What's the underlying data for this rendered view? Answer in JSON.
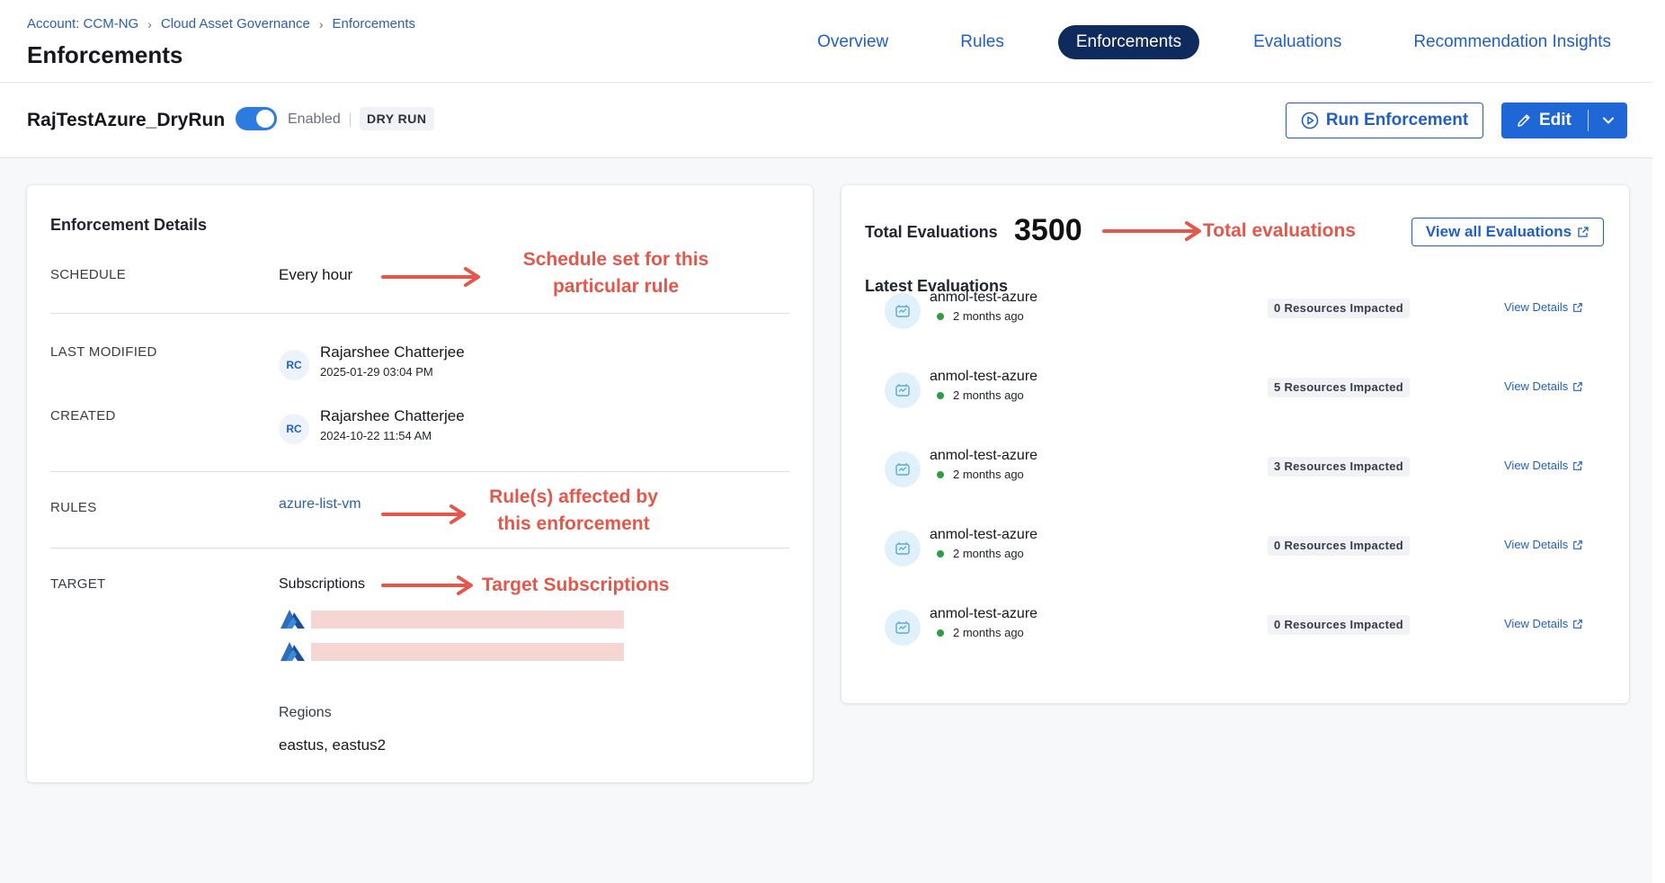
{
  "breadcrumb": {
    "account": "Account: CCM-NG",
    "section": "Cloud Asset Governance",
    "current": "Enforcements"
  },
  "header": {
    "title": "Enforcements"
  },
  "tabs": [
    "Overview",
    "Rules",
    "Enforcements",
    "Evaluations",
    "Recommendation Insights"
  ],
  "active_tab": "Enforcements",
  "enforcement": {
    "name": "RajTestAzure_DryRun",
    "enabled": true,
    "enabled_label": "Enabled",
    "mode_badge": "DRY RUN",
    "run_button": "Run Enforcement",
    "edit_button": "Edit"
  },
  "details": {
    "title": "Enforcement Details",
    "schedule_label": "SCHEDULE",
    "schedule_value": "Every hour",
    "last_modified_label": "LAST MODIFIED",
    "last_modified": {
      "initials": "RC",
      "name": "Rajarshee Chatterjee",
      "date": "2025-01-29 03:04 PM"
    },
    "created_label": "CREATED",
    "created": {
      "initials": "RC",
      "name": "Rajarshee Chatterjee",
      "date": "2024-10-22 11:54 AM"
    },
    "rules_label": "RULES",
    "rule": "azure-list-vm",
    "target_label": "TARGET",
    "subscriptions_label": "Subscriptions",
    "regions_label": "Regions",
    "regions": "eastus, eastus2"
  },
  "evaluations": {
    "total_label": "Total Evaluations",
    "total": "3500",
    "view_all": "View all Evaluations",
    "latest_label": "Latest Evaluations",
    "items": [
      {
        "name": "anmol-test-azure",
        "time": "2 months ago",
        "impact": "0 Resources Impacted",
        "link": "View Details"
      },
      {
        "name": "anmol-test-azure",
        "time": "2 months ago",
        "impact": "5 Resources Impacted",
        "link": "View Details"
      },
      {
        "name": "anmol-test-azure",
        "time": "2 months ago",
        "impact": "3 Resources Impacted",
        "link": "View Details"
      },
      {
        "name": "anmol-test-azure",
        "time": "2 months ago",
        "impact": "0 Resources Impacted",
        "link": "View Details"
      },
      {
        "name": "anmol-test-azure",
        "time": "2 months ago",
        "impact": "0 Resources Impacted",
        "link": "View Details"
      }
    ]
  },
  "annotations": {
    "schedule": "Schedule set for this particular rule",
    "rules": "Rule(s) affected by this enforcement",
    "target": "Target Subscriptions",
    "total": "Total evaluations"
  },
  "colors": {
    "accent": "#1f5fc7",
    "nav_active": "#0f2a5c",
    "annotation": "#e5574b",
    "status_ok": "#2e9e44"
  },
  "icons": [
    "chevron-right-icon",
    "toggle-switch",
    "play-circle-icon",
    "pencil-icon",
    "chevron-down-icon",
    "azure-logo",
    "external-link-icon",
    "evaluation-icon",
    "arrow-right-icon"
  ]
}
